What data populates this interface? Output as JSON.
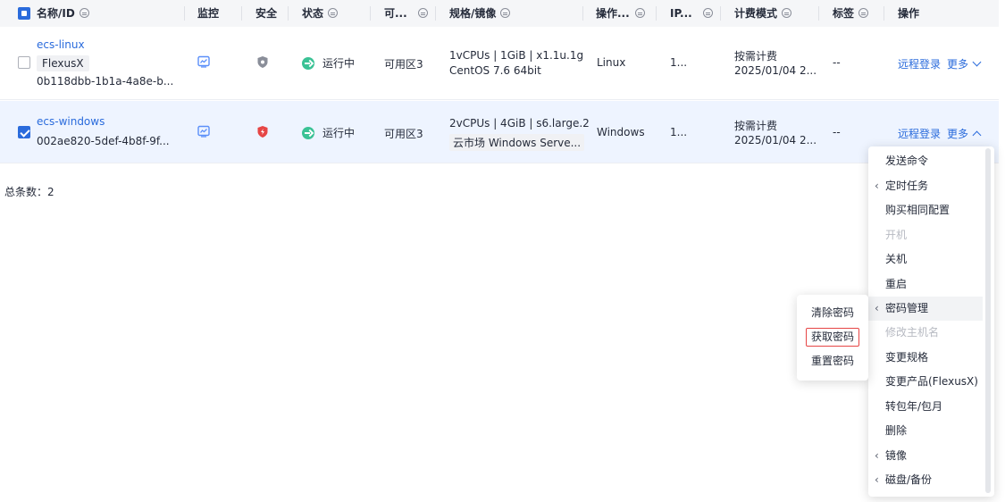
{
  "header": {
    "name": "名称/ID",
    "monitor": "监控",
    "security": "安全",
    "status": "状态",
    "az": "可...",
    "spec": "规格/镜像",
    "os": "操作...",
    "ip": "IP...",
    "billing": "计费模式",
    "tags": "标签",
    "actions": "操作"
  },
  "rows": [
    {
      "name": "ecs-linux",
      "tag": "FlexusX",
      "id": "0b118dbb-1b1a-4a8e-b...",
      "status": "运行中",
      "az": "可用区3",
      "spec_line1": "1vCPUs | 1GiB | x1.1u.1g",
      "spec_line2": "CentOS 7.6 64bit",
      "os": "Linux",
      "ip": "1...",
      "billing_line1": "按需计费",
      "billing_line2": "2025/01/04 2...",
      "tags": "--",
      "remote": "远程登录",
      "more": "更多",
      "checked": false
    },
    {
      "name": "ecs-windows",
      "id": "002ae820-5def-4b8f-9f...",
      "status": "运行中",
      "az": "可用区3",
      "spec_line1": "2vCPUs | 4GiB | s6.large.2",
      "spec_line2": "云市场  Windows Serve...",
      "os": "Windows",
      "ip": "1...",
      "billing_line1": "按需计费",
      "billing_line2": "2025/01/04 2...",
      "tags": "--",
      "remote": "远程登录",
      "more": "更多",
      "checked": true
    }
  ],
  "total_label": "总条数：2",
  "more_menu": [
    {
      "label": "发送命令",
      "submenu": false,
      "disabled": false
    },
    {
      "label": "定时任务",
      "submenu": true,
      "disabled": false
    },
    {
      "label": "购买相同配置",
      "submenu": false,
      "disabled": false
    },
    {
      "label": "开机",
      "submenu": false,
      "disabled": true
    },
    {
      "label": "关机",
      "submenu": false,
      "disabled": false
    },
    {
      "label": "重启",
      "submenu": false,
      "disabled": false
    },
    {
      "label": "密码管理",
      "submenu": true,
      "disabled": false,
      "active": true
    },
    {
      "label": "修改主机名",
      "submenu": false,
      "disabled": true
    },
    {
      "label": "变更规格",
      "submenu": false,
      "disabled": false
    },
    {
      "label": "变更产品(FlexusX)",
      "submenu": false,
      "disabled": false
    },
    {
      "label": "转包年/包月",
      "submenu": false,
      "disabled": false
    },
    {
      "label": "删除",
      "submenu": false,
      "disabled": false
    },
    {
      "label": "镜像",
      "submenu": true,
      "disabled": false
    },
    {
      "label": "磁盘/备份",
      "submenu": true,
      "disabled": false
    }
  ],
  "password_submenu": [
    {
      "label": "清除密码"
    },
    {
      "label": "获取密码",
      "highlighted": true
    },
    {
      "label": "重置密码"
    }
  ],
  "colors": {
    "link": "#2a6bdc",
    "running": "#3ac295",
    "monitor_icon": "#5b8ff9",
    "shield_normal": "#8a8e99",
    "shield_alert": "#e64545",
    "highlight_border": "#e64545"
  }
}
